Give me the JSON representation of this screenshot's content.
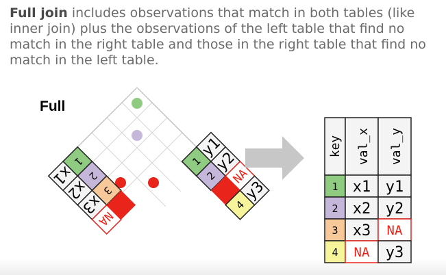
{
  "description": {
    "bold": "Full join",
    "rest": " includes observations that match in both tables (like inner join) plus the observations of the left table that find no match in the right table and those in the right table that find no match in the left table."
  },
  "diagram": {
    "title": "Full",
    "left_table": {
      "keys": [
        "1",
        "2",
        "3"
      ],
      "values": [
        "x1",
        "x2",
        "x3"
      ],
      "missing": "NA"
    },
    "right_table": {
      "keys": [
        "1",
        "2",
        "4"
      ],
      "values": [
        "y1",
        "y2",
        "y3"
      ],
      "missing": "NA"
    },
    "result_table": {
      "headers": [
        "key",
        "val_x",
        "val_y"
      ],
      "rows": [
        [
          "1",
          "x1",
          "y1"
        ],
        [
          "2",
          "x2",
          "y2"
        ],
        [
          "3",
          "x3",
          "NA"
        ],
        [
          "4",
          "NA",
          "y3"
        ]
      ]
    },
    "colors": {
      "key1": "#8fcc82",
      "key2": "#c4b7d9",
      "key3": "#f7c99a",
      "key4": "#f7f59c",
      "na": "#e8241b",
      "match_dot_green": "#8fcc82",
      "match_dot_purple": "#c4b7d9",
      "match_dot_red": "#e8241b",
      "arrow": "#c7c7c7"
    }
  }
}
